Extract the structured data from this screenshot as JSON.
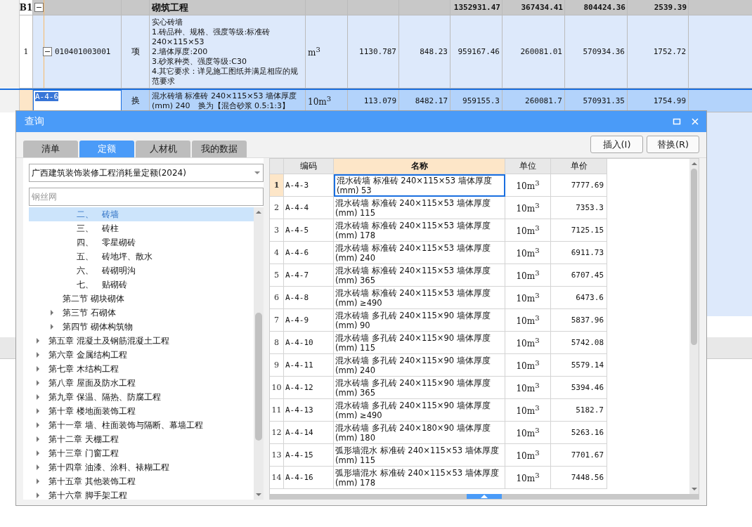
{
  "sheet": {
    "rows": [
      {
        "kind": "group",
        "number": "B1",
        "expanded": true,
        "name": "砌筑工程",
        "values": [
          "1352931.47",
          "367434.41",
          "804424.36",
          "2539.39"
        ],
        "selected": false
      },
      {
        "kind": "item",
        "number": "1",
        "expanded": true,
        "code": "010401003001",
        "type": "项",
        "name": "实心砖墙\n1.砖品种、规格、强度等级:标准砖240×115×53\n2.墙体厚度:200\n3.砂浆种类、强度等级:C30\n4.其它要求：详见施工图纸并满足相应的规范要求",
        "unit": "m$^{3}$",
        "values": [
          "1130.787",
          "848.23",
          "959167.46",
          "260081.01",
          "570934.36",
          "1752.72"
        ],
        "selected": false
      },
      {
        "kind": "quota",
        "code": "A-4-6",
        "type": "换",
        "name": "混水砖墙 标准砖 240×115×53 墙体厚度(mm) 240　换为【混合砂浆 0.5:1:3】",
        "unit": "10m$^{3}$",
        "values": [
          "113.079",
          "8482.17",
          "959155.3",
          "260081.7",
          "570931.35",
          "1754.99"
        ],
        "selected": true
      }
    ]
  },
  "dialog": {
    "title": "查询",
    "tabs": [
      {
        "label": "清单",
        "selected": false
      },
      {
        "label": "定额",
        "selected": true
      },
      {
        "label": "人材机",
        "selected": false
      },
      {
        "label": "我的数据",
        "selected": false
      }
    ],
    "buttons": [
      "插入(I)",
      "替换(R)"
    ],
    "library": "广西建筑装饰装修工程消耗量定额(2024)",
    "search": {
      "placeholder": "钢丝网"
    },
    "tree": [
      {
        "children": [
          {
            "children": [
              {
                "label": "二、　砖墙",
                "selected": true,
                "has_children": false
              },
              {
                "label": "三、　砖柱",
                "selected": false,
                "has_children": false
              },
              {
                "label": "四、　零星砌砖",
                "selected": false,
                "has_children": false
              },
              {
                "label": "五、　砖地坪、散水",
                "selected": false,
                "has_children": false
              },
              {
                "label": "六、　砖砌明沟",
                "selected": false,
                "has_children": false
              },
              {
                "label": "七、　贴砌砖",
                "selected": false,
                "has_children": false
              }
            ]
          },
          {
            "label": "第二节 砌块砌体",
            "selected": false,
            "has_children": false
          },
          {
            "label": "第三节 石砌体",
            "selected": false,
            "has_children": true
          },
          {
            "label": "第四节 砌体构筑物",
            "selected": false,
            "has_children": true
          }
        ]
      },
      {
        "label": "第五章 混凝土及钢筋混凝土工程",
        "selected": false,
        "has_children": true
      },
      {
        "label": "第六章 金属结构工程",
        "selected": false,
        "has_children": true
      },
      {
        "label": "第七章 木结构工程",
        "selected": false,
        "has_children": true
      },
      {
        "label": "第八章 屋面及防水工程",
        "selected": false,
        "has_children": true
      },
      {
        "label": "第九章 保温、隔热、防腐工程",
        "selected": false,
        "has_children": true
      },
      {
        "label": "第十章 楼地面装饰工程",
        "selected": false,
        "has_children": true
      },
      {
        "label": "第十一章 墙、柱面装饰与隔断、幕墙工程",
        "selected": false,
        "has_children": true
      },
      {
        "label": "第十二章 天棚工程",
        "selected": false,
        "has_children": true
      },
      {
        "label": "第十三章 门窗工程",
        "selected": false,
        "has_children": true
      },
      {
        "label": "第十四章 油漆、涂料、裱糊工程",
        "selected": false,
        "has_children": true
      },
      {
        "label": "第十五章 其他装饰工程",
        "selected": false,
        "has_children": true
      },
      {
        "label": "第十六章 脚手架工程",
        "selected": false,
        "has_children": true
      }
    ],
    "table": {
      "columns": [
        {
          "label": "编码",
          "selected": false
        },
        {
          "label": "名称",
          "selected": true
        },
        {
          "label": "单位",
          "selected": false
        },
        {
          "label": "单价",
          "selected": false
        }
      ],
      "rows": [
        {
          "number": "1",
          "code": "A-4-3",
          "name": "混水砖墙 标准砖 240×115×53 墙体厚度(mm) 53",
          "unit": "10m$^{3}$",
          "price": "7777.69",
          "selected": true
        },
        {
          "number": "2",
          "code": "A-4-4",
          "name": "混水砖墙 标准砖 240×115×53 墙体厚度(mm) 115",
          "unit": "10m$^{3}$",
          "price": "7353.3",
          "selected": false
        },
        {
          "number": "3",
          "code": "A-4-5",
          "name": "混水砖墙 标准砖 240×115×53 墙体厚度(mm) 178",
          "unit": "10m$^{3}$",
          "price": "7125.15",
          "selected": false
        },
        {
          "number": "4",
          "code": "A-4-6",
          "name": "混水砖墙 标准砖 240×115×53 墙体厚度(mm) 240",
          "unit": "10m$^{3}$",
          "price": "6911.73",
          "selected": false
        },
        {
          "number": "5",
          "code": "A-4-7",
          "name": "混水砖墙 标准砖 240×115×53 墙体厚度(mm) 365",
          "unit": "10m$^{3}$",
          "price": "6707.45",
          "selected": false
        },
        {
          "number": "6",
          "code": "A-4-8",
          "name": "混水砖墙 标准砖 240×115×53 墙体厚度(mm) ≥490",
          "unit": "10m$^{3}$",
          "price": "6473.6",
          "selected": false
        },
        {
          "number": "7",
          "code": "A-4-9",
          "name": "混水砖墙 多孔砖 240×115×90 墙体厚度(mm) 90",
          "unit": "10m$^{3}$",
          "price": "5837.96",
          "selected": false
        },
        {
          "number": "8",
          "code": "A-4-10",
          "name": "混水砖墙 多孔砖 240×115×90 墙体厚度(mm) 115",
          "unit": "10m$^{3}$",
          "price": "5742.08",
          "selected": false
        },
        {
          "number": "9",
          "code": "A-4-11",
          "name": "混水砖墙 多孔砖 240×115×90 墙体厚度(mm) 240",
          "unit": "10m$^{3}$",
          "price": "5579.14",
          "selected": false
        },
        {
          "number": "10",
          "code": "A-4-12",
          "name": "混水砖墙 多孔砖 240×115×90 墙体厚度(mm) 365",
          "unit": "10m$^{3}$",
          "price": "5394.46",
          "selected": false
        },
        {
          "number": "11",
          "code": "A-4-13",
          "name": "混水砖墙 多孔砖 240×115×90 墙体厚度(mm) ≥490",
          "unit": "10m$^{3}$",
          "price": "5182.7",
          "selected": false
        },
        {
          "number": "12",
          "code": "A-4-14",
          "name": "混水砖墙 多孔砖 240×180×90 墙体厚度(mm) 180",
          "unit": "10m$^{3}$",
          "price": "5263.16",
          "selected": false
        },
        {
          "number": "13",
          "code": "A-4-15",
          "name": "弧形墙混水 标准砖 240×115×53 墙体厚度(mm) 115",
          "unit": "10m$^{3}$",
          "price": "7701.67",
          "selected": false
        },
        {
          "number": "14",
          "code": "A-4-16",
          "name": "弧形墙混水 标准砖 240×115×53 墙体厚度(mm) 178",
          "unit": "10m$^{3}$",
          "price": "7448.56",
          "selected": false
        }
      ]
    }
  }
}
